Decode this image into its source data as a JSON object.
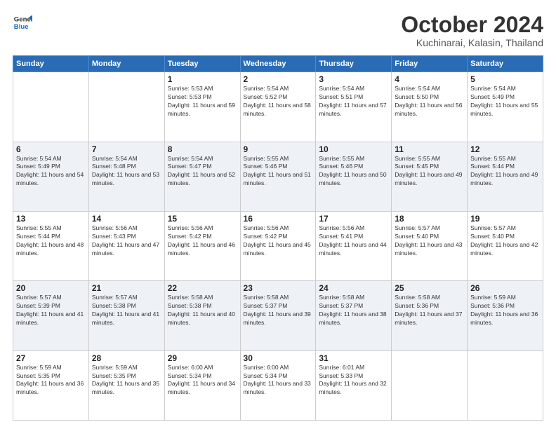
{
  "header": {
    "logo_line1": "General",
    "logo_line2": "Blue",
    "month": "October 2024",
    "location": "Kuchinarai, Kalasin, Thailand"
  },
  "weekdays": [
    "Sunday",
    "Monday",
    "Tuesday",
    "Wednesday",
    "Thursday",
    "Friday",
    "Saturday"
  ],
  "weeks": [
    [
      {
        "day": "",
        "sunrise": "",
        "sunset": "",
        "daylight": ""
      },
      {
        "day": "",
        "sunrise": "",
        "sunset": "",
        "daylight": ""
      },
      {
        "day": "1",
        "sunrise": "Sunrise: 5:53 AM",
        "sunset": "Sunset: 5:53 PM",
        "daylight": "Daylight: 11 hours and 59 minutes."
      },
      {
        "day": "2",
        "sunrise": "Sunrise: 5:54 AM",
        "sunset": "Sunset: 5:52 PM",
        "daylight": "Daylight: 11 hours and 58 minutes."
      },
      {
        "day": "3",
        "sunrise": "Sunrise: 5:54 AM",
        "sunset": "Sunset: 5:51 PM",
        "daylight": "Daylight: 11 hours and 57 minutes."
      },
      {
        "day": "4",
        "sunrise": "Sunrise: 5:54 AM",
        "sunset": "Sunset: 5:50 PM",
        "daylight": "Daylight: 11 hours and 56 minutes."
      },
      {
        "day": "5",
        "sunrise": "Sunrise: 5:54 AM",
        "sunset": "Sunset: 5:49 PM",
        "daylight": "Daylight: 11 hours and 55 minutes."
      }
    ],
    [
      {
        "day": "6",
        "sunrise": "Sunrise: 5:54 AM",
        "sunset": "Sunset: 5:49 PM",
        "daylight": "Daylight: 11 hours and 54 minutes."
      },
      {
        "day": "7",
        "sunrise": "Sunrise: 5:54 AM",
        "sunset": "Sunset: 5:48 PM",
        "daylight": "Daylight: 11 hours and 53 minutes."
      },
      {
        "day": "8",
        "sunrise": "Sunrise: 5:54 AM",
        "sunset": "Sunset: 5:47 PM",
        "daylight": "Daylight: 11 hours and 52 minutes."
      },
      {
        "day": "9",
        "sunrise": "Sunrise: 5:55 AM",
        "sunset": "Sunset: 5:46 PM",
        "daylight": "Daylight: 11 hours and 51 minutes."
      },
      {
        "day": "10",
        "sunrise": "Sunrise: 5:55 AM",
        "sunset": "Sunset: 5:46 PM",
        "daylight": "Daylight: 11 hours and 50 minutes."
      },
      {
        "day": "11",
        "sunrise": "Sunrise: 5:55 AM",
        "sunset": "Sunset: 5:45 PM",
        "daylight": "Daylight: 11 hours and 49 minutes."
      },
      {
        "day": "12",
        "sunrise": "Sunrise: 5:55 AM",
        "sunset": "Sunset: 5:44 PM",
        "daylight": "Daylight: 11 hours and 49 minutes."
      }
    ],
    [
      {
        "day": "13",
        "sunrise": "Sunrise: 5:55 AM",
        "sunset": "Sunset: 5:44 PM",
        "daylight": "Daylight: 11 hours and 48 minutes."
      },
      {
        "day": "14",
        "sunrise": "Sunrise: 5:56 AM",
        "sunset": "Sunset: 5:43 PM",
        "daylight": "Daylight: 11 hours and 47 minutes."
      },
      {
        "day": "15",
        "sunrise": "Sunrise: 5:56 AM",
        "sunset": "Sunset: 5:42 PM",
        "daylight": "Daylight: 11 hours and 46 minutes."
      },
      {
        "day": "16",
        "sunrise": "Sunrise: 5:56 AM",
        "sunset": "Sunset: 5:42 PM",
        "daylight": "Daylight: 11 hours and 45 minutes."
      },
      {
        "day": "17",
        "sunrise": "Sunrise: 5:56 AM",
        "sunset": "Sunset: 5:41 PM",
        "daylight": "Daylight: 11 hours and 44 minutes."
      },
      {
        "day": "18",
        "sunrise": "Sunrise: 5:57 AM",
        "sunset": "Sunset: 5:40 PM",
        "daylight": "Daylight: 11 hours and 43 minutes."
      },
      {
        "day": "19",
        "sunrise": "Sunrise: 5:57 AM",
        "sunset": "Sunset: 5:40 PM",
        "daylight": "Daylight: 11 hours and 42 minutes."
      }
    ],
    [
      {
        "day": "20",
        "sunrise": "Sunrise: 5:57 AM",
        "sunset": "Sunset: 5:39 PM",
        "daylight": "Daylight: 11 hours and 41 minutes."
      },
      {
        "day": "21",
        "sunrise": "Sunrise: 5:57 AM",
        "sunset": "Sunset: 5:38 PM",
        "daylight": "Daylight: 11 hours and 41 minutes."
      },
      {
        "day": "22",
        "sunrise": "Sunrise: 5:58 AM",
        "sunset": "Sunset: 5:38 PM",
        "daylight": "Daylight: 11 hours and 40 minutes."
      },
      {
        "day": "23",
        "sunrise": "Sunrise: 5:58 AM",
        "sunset": "Sunset: 5:37 PM",
        "daylight": "Daylight: 11 hours and 39 minutes."
      },
      {
        "day": "24",
        "sunrise": "Sunrise: 5:58 AM",
        "sunset": "Sunset: 5:37 PM",
        "daylight": "Daylight: 11 hours and 38 minutes."
      },
      {
        "day": "25",
        "sunrise": "Sunrise: 5:58 AM",
        "sunset": "Sunset: 5:36 PM",
        "daylight": "Daylight: 11 hours and 37 minutes."
      },
      {
        "day": "26",
        "sunrise": "Sunrise: 5:59 AM",
        "sunset": "Sunset: 5:36 PM",
        "daylight": "Daylight: 11 hours and 36 minutes."
      }
    ],
    [
      {
        "day": "27",
        "sunrise": "Sunrise: 5:59 AM",
        "sunset": "Sunset: 5:35 PM",
        "daylight": "Daylight: 11 hours and 36 minutes."
      },
      {
        "day": "28",
        "sunrise": "Sunrise: 5:59 AM",
        "sunset": "Sunset: 5:35 PM",
        "daylight": "Daylight: 11 hours and 35 minutes."
      },
      {
        "day": "29",
        "sunrise": "Sunrise: 6:00 AM",
        "sunset": "Sunset: 5:34 PM",
        "daylight": "Daylight: 11 hours and 34 minutes."
      },
      {
        "day": "30",
        "sunrise": "Sunrise: 6:00 AM",
        "sunset": "Sunset: 5:34 PM",
        "daylight": "Daylight: 11 hours and 33 minutes."
      },
      {
        "day": "31",
        "sunrise": "Sunrise: 6:01 AM",
        "sunset": "Sunset: 5:33 PM",
        "daylight": "Daylight: 11 hours and 32 minutes."
      },
      {
        "day": "",
        "sunrise": "",
        "sunset": "",
        "daylight": ""
      },
      {
        "day": "",
        "sunrise": "",
        "sunset": "",
        "daylight": ""
      }
    ]
  ]
}
